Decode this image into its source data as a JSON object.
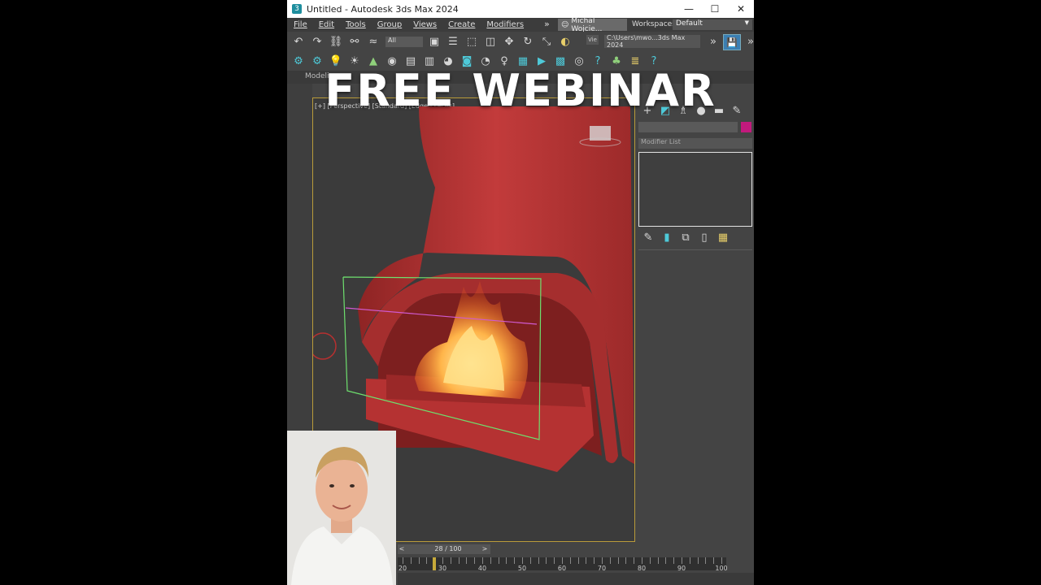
{
  "window": {
    "title": "Untitled - Autodesk 3ds Max 2024",
    "minimize": "—",
    "maximize": "☐",
    "close": "✕"
  },
  "menu": {
    "items": [
      "File",
      "Edit",
      "Tools",
      "Group",
      "Views",
      "Create",
      "Modifiers"
    ],
    "overflow": "»",
    "user": "Michal Wojcie...",
    "workspaces_label": "Workspaces:",
    "workspaces_value": "Default"
  },
  "toolbar": {
    "selection_filter": "All",
    "project_path": "C:\\Users\\mwo...3ds Max 2024",
    "view_label": "Vie"
  },
  "ribbon": {
    "tab": "Modeling"
  },
  "viewport": {
    "label": "[+] [Perspective] [Standard] [Edged Faces]"
  },
  "command_panel": {
    "modifier_list": "Modifier List",
    "color": "#c21a7d"
  },
  "timeline": {
    "frame_display": "28 / 100",
    "prev": "<",
    "next": ">",
    "tick_labels": [
      "20",
      "30",
      "40",
      "50",
      "60",
      "70",
      "80",
      "90",
      "100"
    ],
    "current_frame": 28
  },
  "overlay": {
    "headline": "FREE WEBINAR"
  },
  "colors": {
    "accent_teal": "#4ec9d8",
    "viewport_border": "#b99b3a",
    "object_red": "#b83333",
    "fire_orange": "#ff9a2e"
  }
}
